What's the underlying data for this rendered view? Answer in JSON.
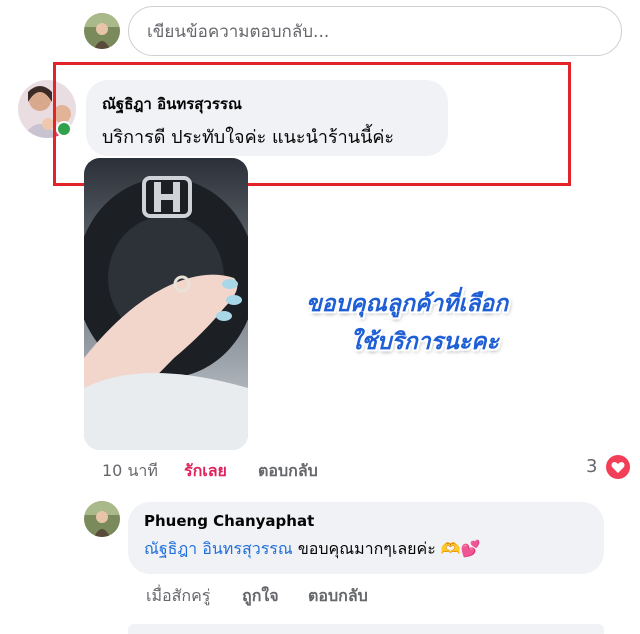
{
  "reply_bar": {
    "placeholder": "เขียนข้อความตอบกลับ..."
  },
  "comment": {
    "author": "ณัฐธิฎา อินทรสุวรรณ",
    "text": "บริการดี ประทับใจค่ะ แนะนำร้านนี้ค่ะ",
    "image_caption_lines": [
      "ขอบคุณลูกค้าที่เลือก",
      "ใช้บริการนะคะ"
    ],
    "time": "10 นาที",
    "like_label": "รักเลย",
    "reply_label": "ตอบกลับ",
    "reaction_count": "3",
    "reaction_icon": "heart-icon"
  },
  "reply": {
    "author": "Phueng Chanyaphat",
    "mention": "ณัฐธิฎา อินทรสุวรรณ",
    "text": "ขอบคุณมากๆเลยค่ะ",
    "emoji": "🫶💕",
    "time": "เมื่อสักครู่",
    "like_label": "ถูกใจ",
    "reply_label": "ตอบกลับ"
  },
  "colors": {
    "highlight": "#e1252b",
    "mention": "#216fdb",
    "love": "#e0245e",
    "online": "#31a24c",
    "bubble": "#f0f2f5"
  }
}
